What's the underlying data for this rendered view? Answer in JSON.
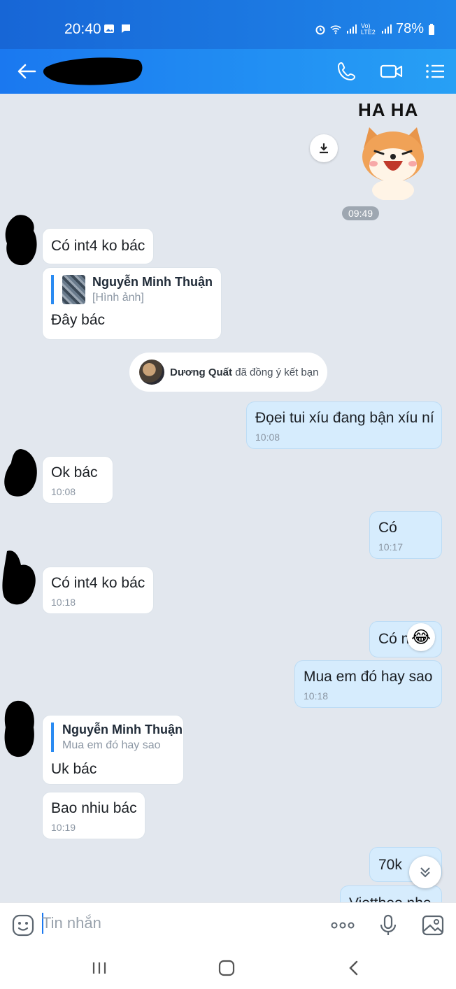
{
  "status_bar": {
    "time": "20:40",
    "battery": "78%",
    "network": "Vo) LTE2"
  },
  "chat": {
    "sticker_caption": "HA HA",
    "time_chip": "09:49",
    "messages": [
      {
        "text": "Có int4 ko bác"
      },
      {
        "quote_name": "Nguyễn Minh Thuận",
        "quote_sub": "[Hình ảnh]",
        "text": "Đây bác"
      },
      {
        "text": "Đọei tui xíu đang bận xíu ní",
        "time": "10:08"
      },
      {
        "text": "Ok bác",
        "time": "10:08"
      },
      {
        "text": "Có",
        "time": "10:17"
      },
      {
        "text": "Có int4 ko bác",
        "time": "10:18"
      },
      {
        "text": "Có n"
      },
      {
        "text": "Mua em đó hay sao",
        "time": "10:18"
      },
      {
        "quote_name": "Nguyễn Minh Thuận",
        "quote_sub": "Mua em đó hay sao",
        "text": "Uk bác"
      },
      {
        "text": "Bao nhiu bác",
        "time": "10:19"
      },
      {
        "text": "70k"
      },
      {
        "text": "Viettheo nhe"
      }
    ],
    "system_message": {
      "name": "Dương Quất",
      "action": "đã đồng ý kết bạn"
    },
    "reaction_emoji": "😂"
  },
  "composer": {
    "placeholder": "Tin nhắn"
  },
  "icons": {
    "back": "arrow-left-icon",
    "call": "phone-icon",
    "video": "video-icon",
    "menu": "list-menu-icon",
    "sticker": "smiley-icon",
    "more": "more-dots-icon",
    "mic": "microphone-icon",
    "image": "image-icon"
  },
  "colors": {
    "header_start": "#1a78f0",
    "header_end": "#27a0f5",
    "chat_bg": "#e2e7ee",
    "my_bubble": "#d6ecfd"
  }
}
